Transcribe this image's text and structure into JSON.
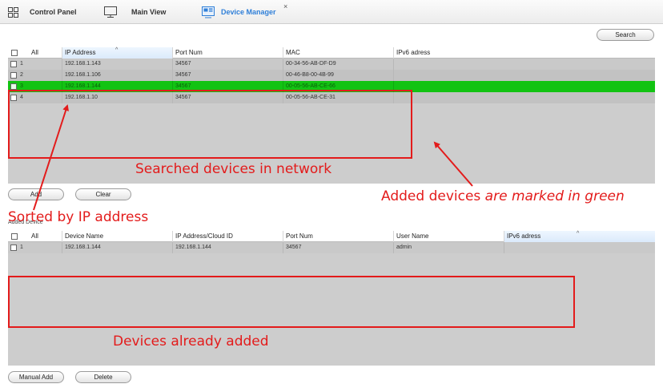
{
  "tabs": [
    {
      "label": "Control Panel",
      "icon": "grid-icon"
    },
    {
      "label": "Main View",
      "icon": "monitor-icon"
    },
    {
      "label": "Device Manager",
      "icon": "device-manager-icon",
      "close": "×"
    }
  ],
  "search": {
    "label": "Search"
  },
  "searched_table": {
    "headers": [
      "All",
      "IP Address",
      "Port Num",
      "MAC",
      "IPv6 adress"
    ],
    "rows": [
      {
        "num": "1",
        "ip": "192.168.1.143",
        "port": "34567",
        "mac": "00-34-56-AB-DF-D9",
        "ipv6": ""
      },
      {
        "num": "2",
        "ip": "192.168.1.106",
        "port": "34567",
        "mac": "00-46-B8-00-4B-99",
        "ipv6": ""
      },
      {
        "num": "3",
        "ip": "192.168.1.144",
        "port": "34567",
        "mac": "00-05-56-AB-CE-66",
        "ipv6": ""
      },
      {
        "num": "4",
        "ip": "192.168.1.10",
        "port": "34567",
        "mac": "00-05-56-AB-CE-31",
        "ipv6": ""
      }
    ]
  },
  "buttons": {
    "add": "Add",
    "clear": "Clear",
    "manual_add": "Manual Add",
    "delete": "Delete"
  },
  "added_section_label": "Added Device",
  "added_table": {
    "headers": [
      "All",
      "Device Name",
      "IP Address/Cloud ID",
      "Port Num",
      "User Name",
      "IPv6 adress"
    ],
    "rows": [
      {
        "num": "1",
        "name": "192.168.1.144",
        "ip": "192.168.1.144",
        "port": "34567",
        "user": "admin",
        "ipv6": ""
      }
    ]
  },
  "annotations": {
    "searched": "Searched devices in network",
    "added_prefix": "Added devices ",
    "added_italic": "are marked in green",
    "sorted": "Sorted by IP address",
    "already": "Devices already added"
  },
  "colors": {
    "highlight": "#12c312",
    "annotation": "#e31b1b",
    "accent": "#2f7fd8"
  }
}
